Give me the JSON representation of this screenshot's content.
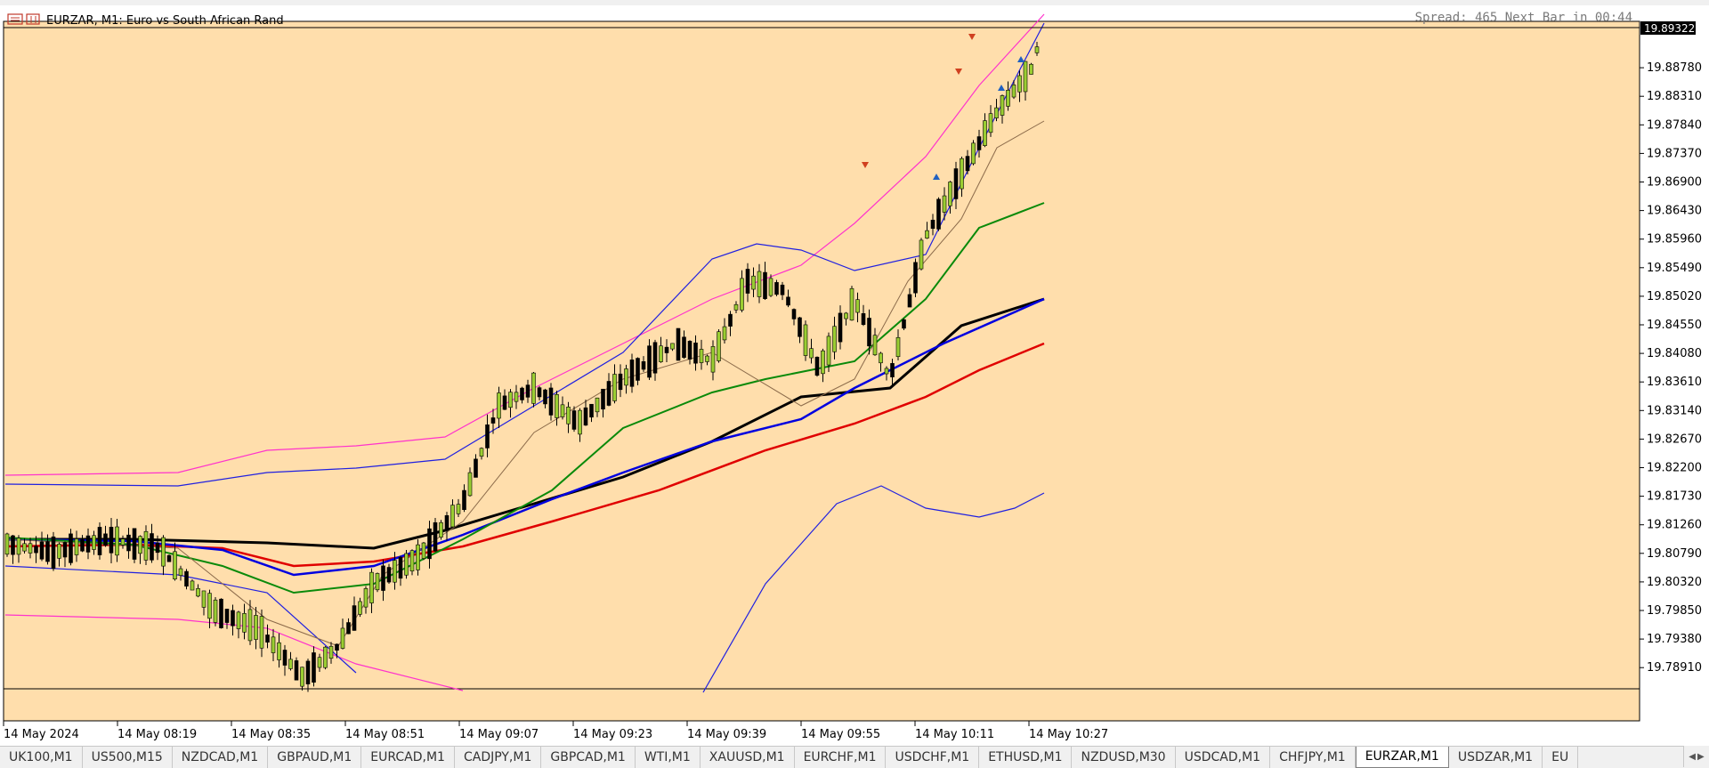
{
  "window": {
    "title": "EURZAR, M1:  Euro vs South African Rand",
    "spread_text": "Spread: 465 Next Bar in 00:44",
    "current_price": "19.89322"
  },
  "colors": {
    "background": "#ffdeac",
    "bull_candle": "#9acd32",
    "bear_candle": "#000000",
    "ma_green": "#0a8a0a",
    "ma_blue": "#0000e0",
    "ma_red": "#e00000",
    "ma_black": "#000000",
    "bollinger_blue": "#2020e0",
    "bollinger_magenta": "#ff33cc",
    "envelope_brown": "#8b6a4a"
  },
  "price_axis": [
    "19.89322",
    "19.88780",
    "19.88310",
    "19.87840",
    "19.87370",
    "19.86900",
    "19.86430",
    "19.85960",
    "19.85490",
    "19.85020",
    "19.84550",
    "19.84080",
    "19.83610",
    "19.83140",
    "19.82670",
    "19.82200",
    "19.81730",
    "19.81260",
    "19.80790",
    "19.80320",
    "19.79850",
    "19.79380",
    "19.78910"
  ],
  "time_axis": [
    "14 May 2024",
    "14 May 08:19",
    "14 May 08:35",
    "14 May 08:51",
    "14 May 09:07",
    "14 May 09:23",
    "14 May 09:39",
    "14 May 09:55",
    "14 May 10:11",
    "14 May 10:27"
  ],
  "tabs": [
    {
      "label": "UK100,M1"
    },
    {
      "label": "US500,M15"
    },
    {
      "label": "NZDCAD,M1"
    },
    {
      "label": "GBPAUD,M1"
    },
    {
      "label": "EURCAD,M1"
    },
    {
      "label": "CADJPY,M1"
    },
    {
      "label": "GBPCAD,M1"
    },
    {
      "label": "WTI,M1"
    },
    {
      "label": "XAUUSD,M1"
    },
    {
      "label": "EURCHF,M1"
    },
    {
      "label": "USDCHF,M1"
    },
    {
      "label": "ETHUSD,M1"
    },
    {
      "label": "NZDUSD,M30"
    },
    {
      "label": "USDCAD,M1"
    },
    {
      "label": "CHFJPY,M1"
    },
    {
      "label": "EURZAR,M1",
      "active": true
    },
    {
      "label": "USDZAR,M1"
    },
    {
      "label": "EU"
    }
  ]
}
